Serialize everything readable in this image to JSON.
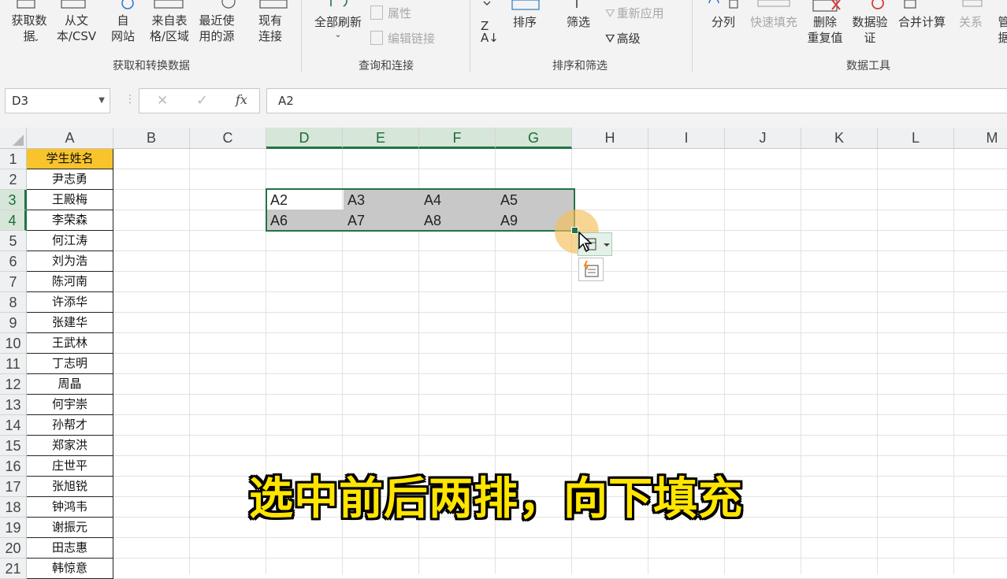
{
  "ribbon": {
    "buttons": {
      "get_data": "获取数\n据",
      "from_text": "从文\n本/CSV",
      "from_web": "自\n网站",
      "from_table": "来自表\n格/区域",
      "recent_sources": "最近使\n用的源",
      "existing_conn": "现有\n连接",
      "refresh_all": "全部刷新",
      "properties": "属性",
      "edit_links": "编辑链接",
      "sort": "排序",
      "filter": "筛选",
      "reapply": "重新应用",
      "advanced": "高级",
      "split_column": "分列",
      "flash_fill": "快速填充",
      "remove_duplicates": "删除\n重复值",
      "data_validation": "数据验\n证",
      "consolidate": "合并计算",
      "relationships": "关系",
      "manage": "管\n据"
    },
    "groups": {
      "get_transform": "获取和转换数据",
      "query_conn": "查询和连接",
      "sort_filter": "排序和筛选",
      "data_tools": "数据工具"
    },
    "colors": {
      "green": "#217346",
      "red": "#d83b3b",
      "blue": "#2b79c7"
    }
  },
  "formula_bar": {
    "name_box": "D3",
    "formula": "A2",
    "fx": "fx",
    "cancel": "✕",
    "enter": "✓"
  },
  "columns": [
    "A",
    "B",
    "C",
    "D",
    "E",
    "F",
    "G",
    "H",
    "I",
    "J",
    "K",
    "L",
    "M"
  ],
  "rows": [
    "1",
    "2",
    "3",
    "4",
    "5",
    "6",
    "7",
    "8",
    "9",
    "10",
    "11",
    "12",
    "13",
    "14",
    "15",
    "16",
    "17",
    "18",
    "19",
    "20",
    "21"
  ],
  "column_a": [
    "学生姓名",
    "尹志勇",
    "王殿梅",
    "李荣森",
    "何江涛",
    "刘为浩",
    "陈河南",
    "许添华",
    "张建华",
    "王武林",
    "丁志明",
    "周晶",
    "何宇崇",
    "孙帮才",
    "郑家洪",
    "庄世平",
    "张旭锐",
    "钟鸿韦",
    "谢振元",
    "田志惠",
    "韩惊意"
  ],
  "selection_cells": {
    "row3": [
      "A2",
      "A3",
      "A4",
      "A5"
    ],
    "row4": [
      "A6",
      "A7",
      "A8",
      "A9"
    ]
  },
  "caption": "选中前后两排，向下填充",
  "colors": {
    "header_fill": "#f8c32b",
    "selection_border": "#217346",
    "selection_fill": "#c8c8c8",
    "caption": "#ffe500"
  }
}
